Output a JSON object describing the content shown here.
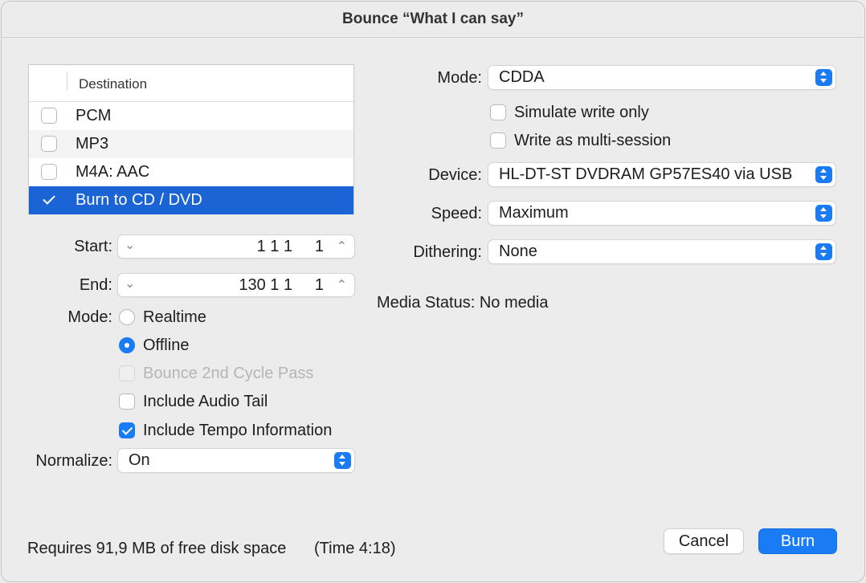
{
  "window": {
    "title": "Bounce “What I can say”"
  },
  "destination": {
    "header": "Destination",
    "rows": [
      {
        "label": "PCM",
        "checked": false
      },
      {
        "label": "MP3",
        "checked": false
      },
      {
        "label": "M4A: AAC",
        "checked": false
      },
      {
        "label": "Burn to CD / DVD",
        "checked": true,
        "selected": true
      }
    ]
  },
  "range": {
    "start_label": "Start:",
    "start_value": "1 1 1     1",
    "end_label": "End:",
    "end_value": "130 1 1     1"
  },
  "bounce_mode": {
    "label": "Mode:",
    "options": [
      {
        "label": "Realtime",
        "selected": false
      },
      {
        "label": "Offline",
        "selected": true
      }
    ]
  },
  "options": {
    "cycle_pass": {
      "label": "Bounce 2nd Cycle Pass",
      "checked": false,
      "disabled": true
    },
    "audio_tail": {
      "label": "Include Audio Tail",
      "checked": false
    },
    "tempo_info": {
      "label": "Include Tempo Information",
      "checked": true
    }
  },
  "normalize": {
    "label": "Normalize:",
    "value": "On"
  },
  "burn": {
    "mode_label": "Mode:",
    "mode_value": "CDDA",
    "simulate": {
      "label": "Simulate write only",
      "checked": false
    },
    "multisession": {
      "label": "Write as multi-session",
      "checked": false
    },
    "device_label": "Device:",
    "device_value": "HL-DT-ST DVDRAM GP57ES40 via USB",
    "speed_label": "Speed:",
    "speed_value": "Maximum",
    "dithering_label": "Dithering:",
    "dithering_value": "None",
    "media_status": "Media Status: No media"
  },
  "footer": {
    "disk_space": "Requires 91,9 MB of free disk space",
    "time": "(Time 4:18)",
    "cancel": "Cancel",
    "burn": "Burn"
  },
  "colors": {
    "accent": "#1a7cf5",
    "selection": "#1a64d6",
    "window_bg": "#ececec"
  }
}
